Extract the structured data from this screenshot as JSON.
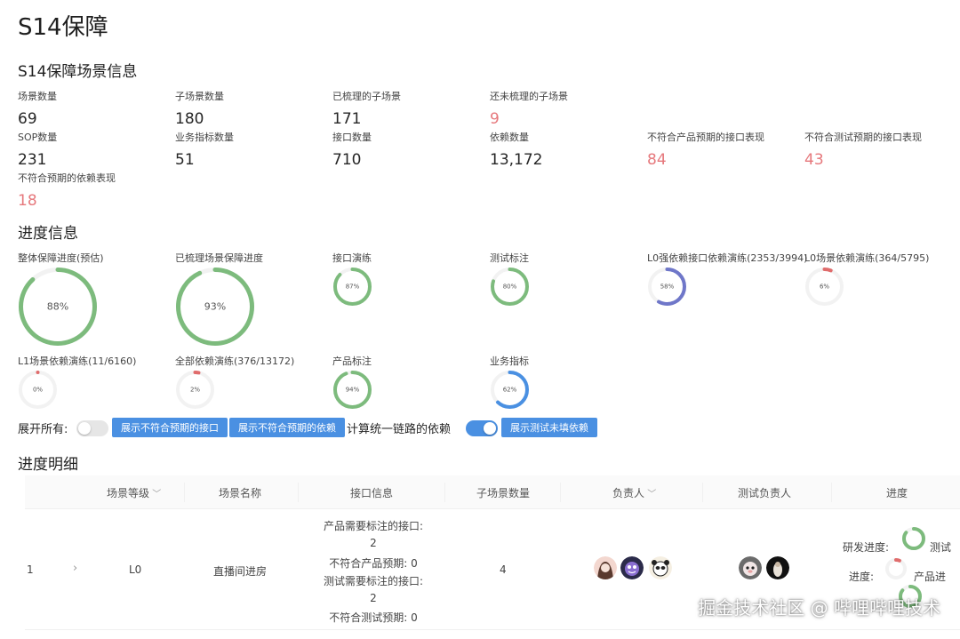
{
  "page": {
    "title": "S14保障"
  },
  "scene_info": {
    "title": "S14保障场景信息",
    "stats": [
      {
        "label": "场景数量",
        "value": "69",
        "warn": false
      },
      {
        "label": "子场景数量",
        "value": "180",
        "warn": false
      },
      {
        "label": "已梳理的子场景",
        "value": "171",
        "warn": false
      },
      {
        "label": "还未梳理的子场景",
        "value": "9",
        "warn": true
      },
      {
        "label": "SOP数量",
        "value": "231",
        "warn": false
      },
      {
        "label": "业务指标数量",
        "value": "51",
        "warn": false
      },
      {
        "label": "接口数量",
        "value": "710",
        "warn": false
      },
      {
        "label": "依赖数量",
        "value": "13,172",
        "warn": false
      },
      {
        "label": "不符合产品预期的接口表现",
        "value": "84",
        "warn": true
      },
      {
        "label": "不符合测试预期的接口表现",
        "value": "43",
        "warn": true
      },
      {
        "label": "不符合预期的依赖表现",
        "value": "18",
        "warn": true
      }
    ]
  },
  "progress_info": {
    "title": "进度信息",
    "rings": [
      {
        "label": "整体保障进度(预估)",
        "percent": 88,
        "text": "88%",
        "color": "#7dbb7d"
      },
      {
        "label": "已梳理场景保障进度",
        "percent": 93,
        "text": "93%",
        "color": "#7dbb7d"
      },
      {
        "label": "接口演练",
        "percent": 87,
        "text": "87%",
        "color": "#7dbb7d"
      },
      {
        "label": "测试标注",
        "percent": 80,
        "text": "80%",
        "color": "#7dbb7d"
      },
      {
        "label": "L0强依赖接口依赖演练(2353/3994)",
        "percent": 58,
        "text": "58%",
        "color": "#6f77c9"
      },
      {
        "label": "L0场景依赖演练(364/5795)",
        "percent": 6,
        "text": "6%",
        "color": "#e06c6c"
      },
      {
        "label": "L1场景依赖演练(11/6160)",
        "percent": 0,
        "text": "0%",
        "color": "#e06c6c"
      },
      {
        "label": "全部依赖演练(376/13172)",
        "percent": 2,
        "text": "2%",
        "color": "#e06c6c"
      },
      {
        "label": "产品标注",
        "percent": 94,
        "text": "94%",
        "color": "#7dbb7d"
      },
      {
        "label": "业务指标",
        "percent": 62,
        "text": "62%",
        "color": "#4a90e2"
      }
    ]
  },
  "controls": {
    "expand_all_label": "展开所有:",
    "expand_all_on": false,
    "btn_show_bad_interfaces": "展示不符合预期的接口",
    "btn_show_bad_deps": "展示不符合预期的依赖",
    "unified_chain_label": "计算统一链路的依赖",
    "unified_chain_on": true,
    "btn_show_untested_deps": "展示测试未填依赖"
  },
  "detail": {
    "title": "进度明细",
    "columns": [
      "场景等级",
      "场景名称",
      "接口信息",
      "子场景数量",
      "负责人",
      "测试负责人",
      "进度"
    ],
    "rows": [
      {
        "index": "1",
        "level": "L0",
        "name": "直播间进房",
        "interface_lines": [
          "产品需要标注的接口:",
          "2",
          "不符合产品预期: 0",
          "测试需要标注的接口:",
          "2",
          "不符合测试预期: 0"
        ],
        "sub_count": "4",
        "progress_labels": [
          "研发进度:",
          "测试",
          "进度:",
          "产品进"
        ]
      }
    ]
  },
  "watermark": "掘金技术社区 @ 哔哩哔哩技术",
  "colors": {
    "accent": "#4a90e2",
    "warn": "#e6787c",
    "good": "#7dbb7d"
  }
}
